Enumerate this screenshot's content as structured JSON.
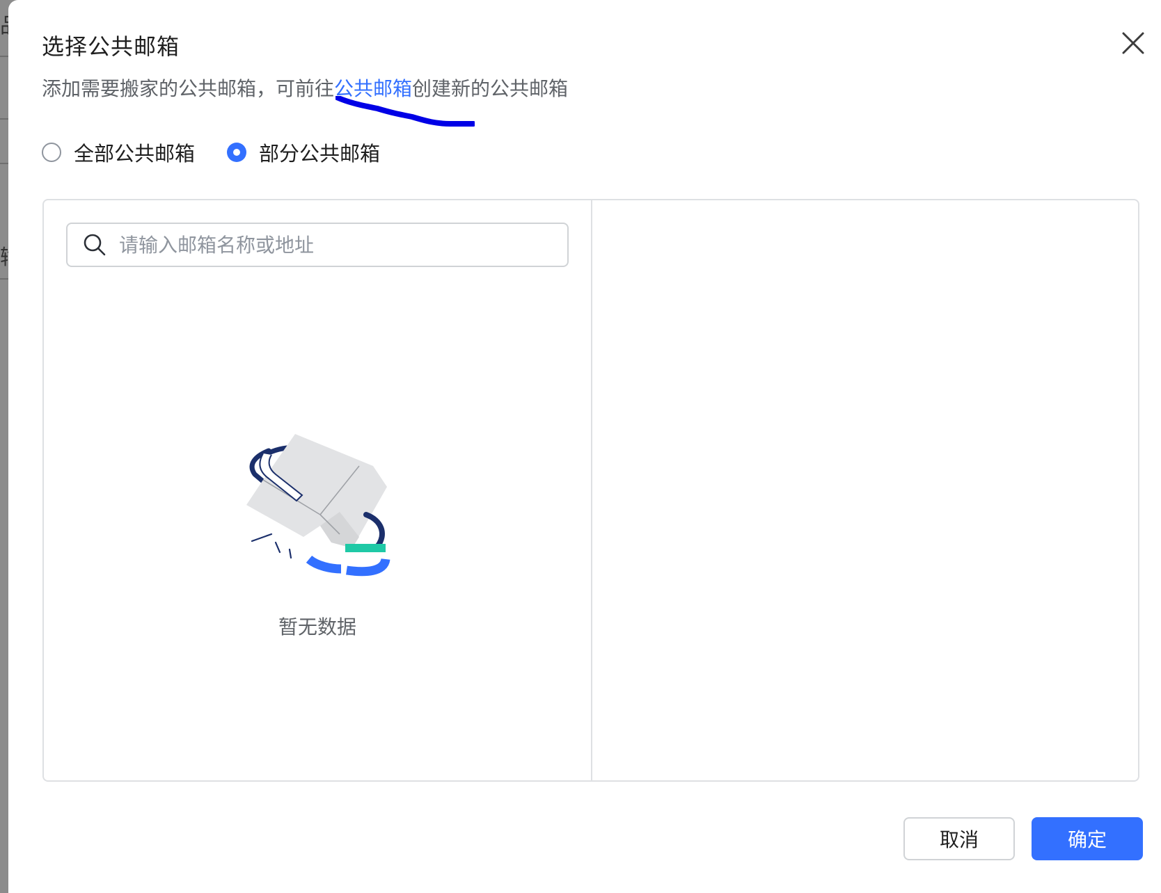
{
  "background": {
    "fragments": [
      "品",
      "输"
    ]
  },
  "dialog": {
    "title": "选择公共邮箱",
    "close_icon": "close-icon",
    "description": {
      "prefix": "添加需要搬家的公共邮箱，可前往",
      "link": "公共邮箱",
      "suffix": "创建新的公共邮箱"
    },
    "radios": [
      {
        "label": "全部公共邮箱",
        "checked": false
      },
      {
        "label": "部分公共邮箱",
        "checked": true
      }
    ],
    "search": {
      "placeholder": "请输入邮箱名称或地址",
      "value": ""
    },
    "empty": {
      "text": "暂无数据",
      "icon": "empty-box-illustration"
    },
    "buttons": {
      "cancel": "取消",
      "ok": "确定"
    },
    "colors": {
      "accent": "#3370ff",
      "annotation": "#0000e6"
    }
  }
}
